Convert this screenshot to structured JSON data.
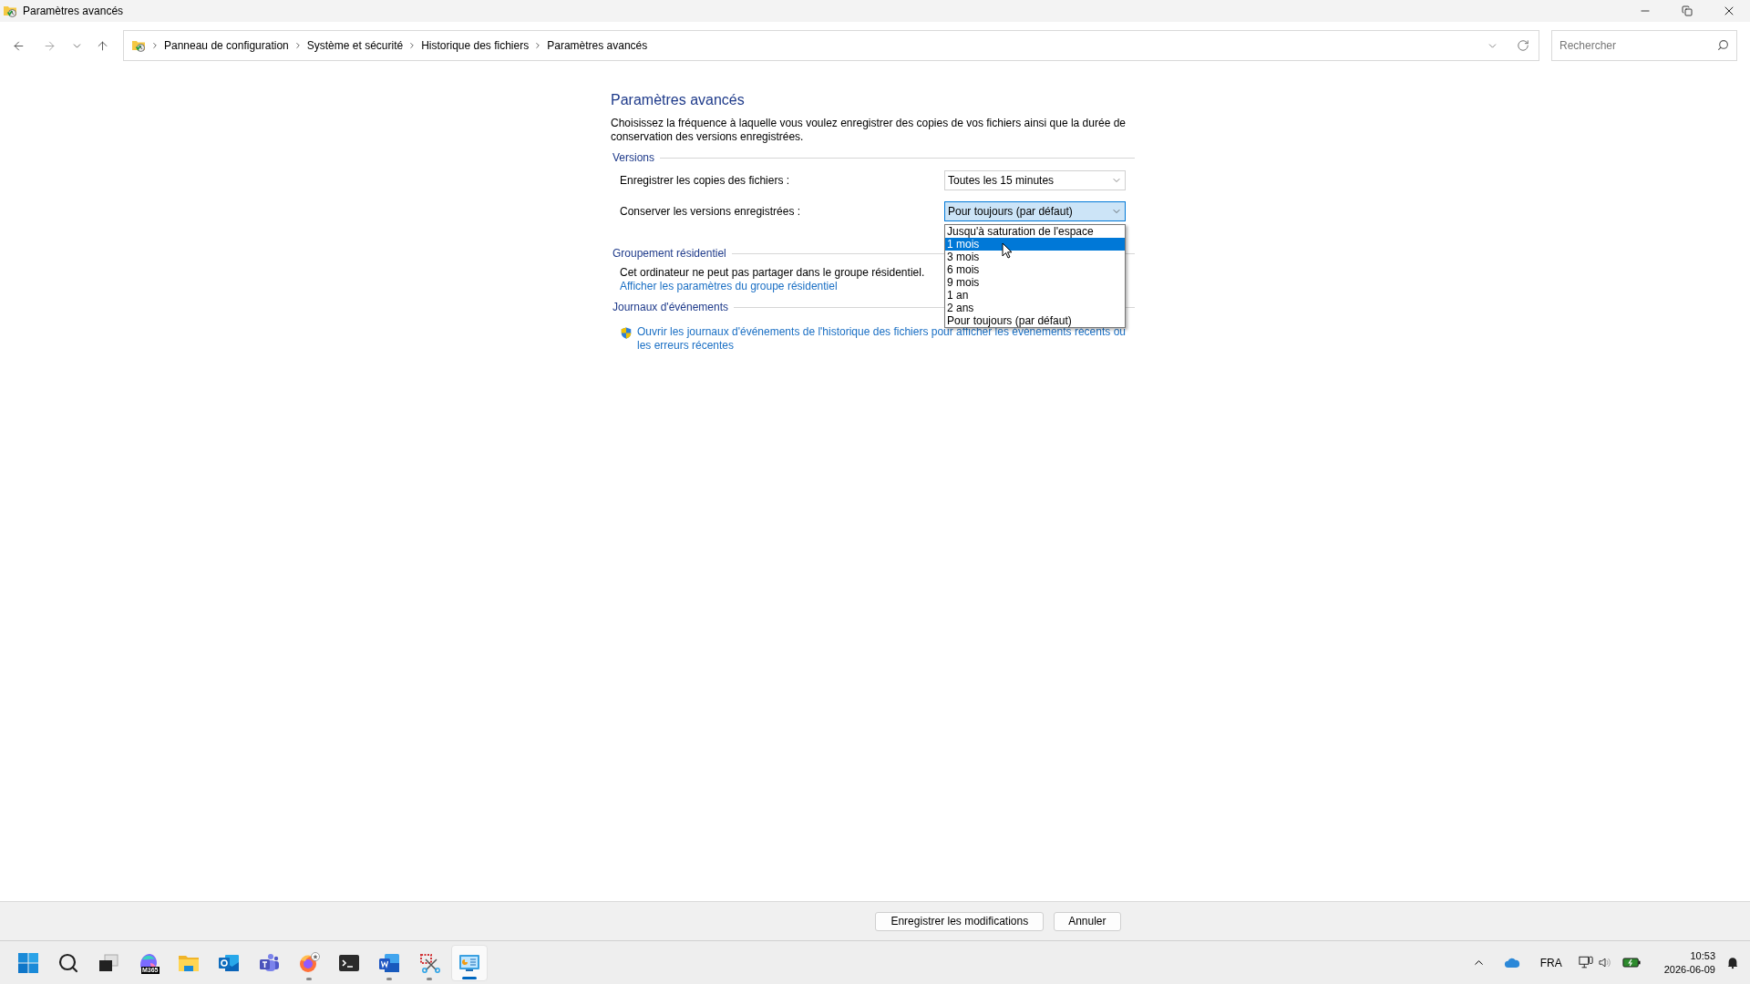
{
  "window": {
    "title": "Paramètres avancés"
  },
  "breadcrumbs": [
    {
      "label": "Panneau de configuration"
    },
    {
      "label": "Système et sécurité"
    },
    {
      "label": "Historique des fichiers"
    },
    {
      "label": "Paramètres avancés"
    }
  ],
  "search": {
    "placeholder": "Rechercher"
  },
  "page": {
    "title": "Paramètres avancés",
    "description": "Choisissez la fréquence à laquelle vous voulez enregistrer des copies de vos fichiers ainsi que la durée de conservation des versions enregistrées."
  },
  "versions": {
    "heading": "Versions",
    "fields": [
      {
        "label": "Enregistrer les copies des fichiers :",
        "value": "Toutes les 15 minutes",
        "open": false
      },
      {
        "label": "Conserver les versions enregistrées :",
        "value": "Pour toujours (par défaut)",
        "open": true,
        "options": [
          {
            "label": "Jusqu'à saturation de l'espace",
            "highlighted": false
          },
          {
            "label": "1 mois",
            "highlighted": true
          },
          {
            "label": "3 mois",
            "highlighted": false
          },
          {
            "label": "6 mois",
            "highlighted": false
          },
          {
            "label": "9 mois",
            "highlighted": false
          },
          {
            "label": "1 an",
            "highlighted": false
          },
          {
            "label": "2 ans",
            "highlighted": false
          },
          {
            "label": "Pour toujours (par défaut)",
            "highlighted": false
          }
        ]
      }
    ]
  },
  "homegroup": {
    "heading": "Groupement résidentiel",
    "text": "Cet ordinateur ne peut pas partager dans le groupe résidentiel.",
    "link": "Afficher les paramètres du groupe résidentiel"
  },
  "event_logs": {
    "heading": "Journaux d'événements",
    "link": "Ouvrir les journaux d'événements de l'historique des fichiers pour afficher les événements récents ou les erreurs récentes"
  },
  "buttons": [
    "Enregistrer les modifications",
    "Annuler"
  ],
  "taskbar": {
    "apps": [
      {
        "kind": "start",
        "running": false,
        "active": false
      },
      {
        "kind": "search",
        "running": false,
        "active": false
      },
      {
        "kind": "taskview",
        "running": false,
        "active": false
      },
      {
        "kind": "m365",
        "badge": "M365",
        "running": false,
        "active": false
      },
      {
        "kind": "explorer",
        "running": false,
        "active": false
      },
      {
        "kind": "outlook",
        "running": false,
        "active": false
      },
      {
        "kind": "teams",
        "running": false,
        "active": false
      },
      {
        "kind": "firefox",
        "running": true,
        "active": false
      },
      {
        "kind": "terminal",
        "running": false,
        "active": false
      },
      {
        "kind": "word",
        "running": true,
        "active": false
      },
      {
        "kind": "snip",
        "running": true,
        "active": false
      },
      {
        "kind": "control",
        "running": true,
        "active": true
      }
    ],
    "language": "FRA",
    "time": "10:53",
    "date": "2026-06-09"
  }
}
